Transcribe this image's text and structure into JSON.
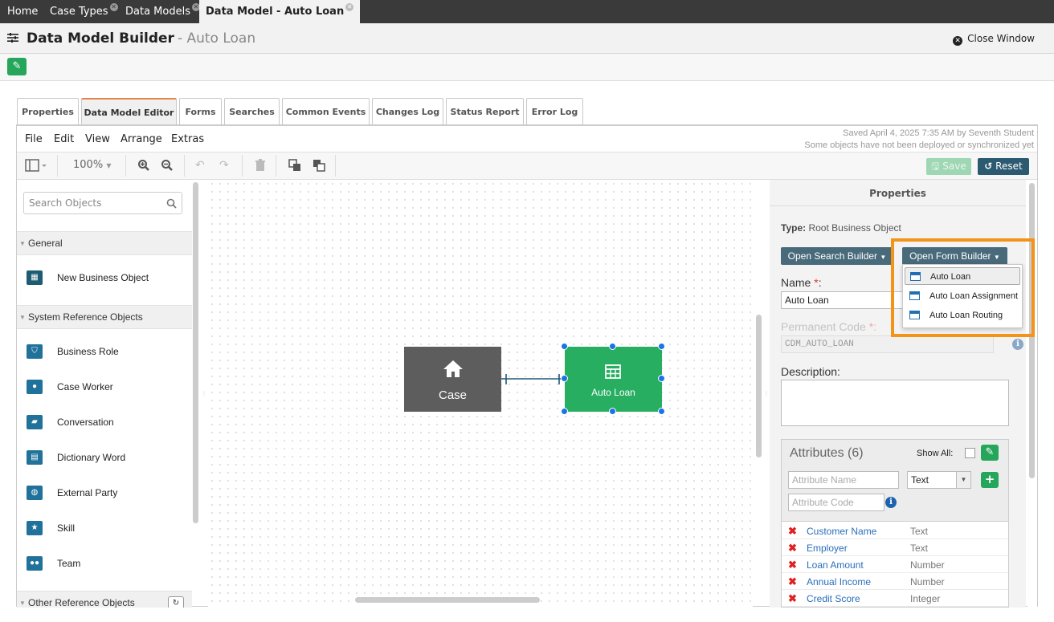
{
  "top_tabs": [
    {
      "label": "Home"
    },
    {
      "label": "Case Types",
      "close": "✕"
    },
    {
      "label": "Data Models",
      "close": "✕"
    },
    {
      "label": "Data Model - Auto Loan",
      "close": "✕"
    }
  ],
  "header": {
    "title": "Data Model Builder",
    "subtitle": "- Auto Loan",
    "close_label": "Close Window"
  },
  "content_tabs": [
    "Properties",
    "Data Model Editor",
    "Forms",
    "Searches",
    "Common Events",
    "Changes Log",
    "Status Report",
    "Error Log"
  ],
  "menus": [
    "File",
    "Edit",
    "View",
    "Arrange",
    "Extras"
  ],
  "saved_status": {
    "line1": "Saved April 4, 2025 7:35 AM by Seventh Student",
    "line2": "Some objects have not been deployed or synchronized yet"
  },
  "toolbar": {
    "zoom": "100%",
    "save_label": "Save",
    "reset_label": "Reset"
  },
  "palette": {
    "search_placeholder": "Search Objects",
    "sections": [
      "General",
      "System Reference Objects",
      "Other Reference Objects"
    ],
    "general_items": [
      {
        "label": "New Business Object",
        "icon": "table-icon"
      }
    ],
    "system_items": [
      {
        "label": "Business Role",
        "icon": "shield-icon"
      },
      {
        "label": "Case Worker",
        "icon": "user-icon"
      },
      {
        "label": "Conversation",
        "icon": "note-icon"
      },
      {
        "label": "Dictionary Word",
        "icon": "document-icon"
      },
      {
        "label": "External Party",
        "icon": "globe-icon"
      },
      {
        "label": "Skill",
        "icon": "star-icon"
      },
      {
        "label": "Team",
        "icon": "group-icon"
      }
    ]
  },
  "canvas": {
    "case_label": "Case",
    "loan_label": "Auto Loan"
  },
  "properties": {
    "title": "Properties",
    "type_label": "Type:",
    "type_value": "Root Business Object",
    "open_search_builder": "Open Search Builder",
    "open_form_builder": "Open Form Builder",
    "name_label": "Name",
    "name_value": "Auto Loan",
    "perm_code_label": "Permanent Code",
    "perm_code_value": "CDM_AUTO_LOAN",
    "description_label": "Description:",
    "required_mark": "*",
    "attributes_title": "Attributes (6)",
    "show_all": "Show All:",
    "attr_name_placeholder": "Attribute Name",
    "attr_code_placeholder": "Attribute Code",
    "attr_type_value": "Text",
    "attributes": [
      {
        "name": "Customer Name",
        "type": "Text"
      },
      {
        "name": "Employer",
        "type": "Text"
      },
      {
        "name": "Loan Amount",
        "type": "Number"
      },
      {
        "name": "Annual Income",
        "type": "Number"
      },
      {
        "name": "Credit Score",
        "type": "Integer"
      }
    ]
  },
  "form_builder_menu": [
    "Auto Loan",
    "Auto Loan Assignment",
    "Auto Loan Routing"
  ],
  "colors": {
    "accent_green": "#27ae60",
    "highlight_orange": "#f39317",
    "dark_teal": "#2c5a70"
  }
}
